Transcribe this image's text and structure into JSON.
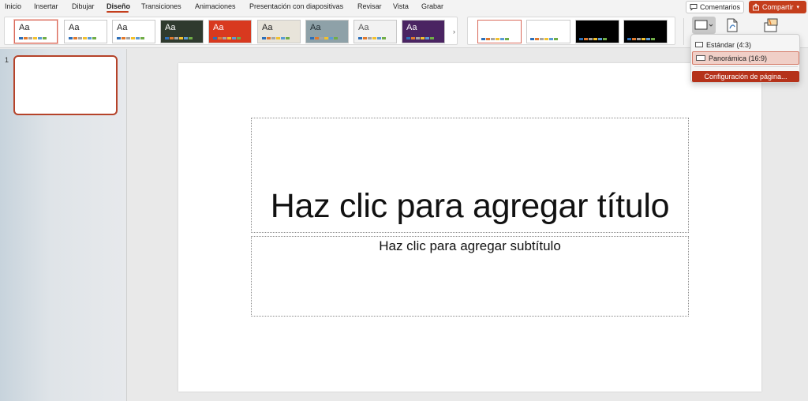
{
  "menu": {
    "tabs": [
      {
        "label": "Inicio"
      },
      {
        "label": "Insertar"
      },
      {
        "label": "Dibujar"
      },
      {
        "label": "Diseño"
      },
      {
        "label": "Transiciones"
      },
      {
        "label": "Animaciones"
      },
      {
        "label": "Presentación con diapositivas"
      },
      {
        "label": "Revisar"
      },
      {
        "label": "Vista"
      },
      {
        "label": "Grabar"
      }
    ],
    "active_tab": "Diseño",
    "comments_label": "Comentarios",
    "share_label": "Compartir"
  },
  "ribbon": {
    "theme_label": "Aa",
    "themes": [
      {
        "name": "blank",
        "bg": "#ffffff",
        "text": "#222222",
        "selected": true
      },
      {
        "name": "office",
        "bg": "#ffffff",
        "text": "#222222",
        "selected": false
      },
      {
        "name": "office-2",
        "bg": "#ffffff",
        "text": "#222222",
        "selected": false
      },
      {
        "name": "dark-green",
        "bg": "#2f3a2e",
        "text": "#ffffff",
        "selected": false
      },
      {
        "name": "red",
        "bg": "#d8391f",
        "text": "#ffffff",
        "selected": false
      },
      {
        "name": "beige",
        "bg": "#e8e4da",
        "text": "#222222",
        "selected": false
      },
      {
        "name": "slate",
        "bg": "#8ea1a8",
        "text": "#1f2a30",
        "selected": false
      },
      {
        "name": "gray-pattern",
        "bg": "#f2f2f2",
        "text": "#555555",
        "selected": false
      },
      {
        "name": "purple",
        "bg": "#4a2462",
        "text": "#ffffff",
        "selected": false
      }
    ],
    "variants": [
      {
        "bg": "#ffffff",
        "selected": true
      },
      {
        "bg": "#ffffff",
        "selected": false
      },
      {
        "bg": "#000000",
        "selected": false
      },
      {
        "bg": "#000000",
        "selected": false
      }
    ]
  },
  "size_dropdown": {
    "items": [
      {
        "label": "Estándar (4:3)",
        "state": "normal"
      },
      {
        "label": "Panorámica (16:9)",
        "state": "hover"
      }
    ],
    "setup_label": "Configuración de página..."
  },
  "slides_panel": {
    "slide_number": "1"
  },
  "slide": {
    "title_placeholder": "Haz clic para agregar título",
    "subtitle_placeholder": "Haz clic para agregar subtítulo"
  },
  "colors": {
    "accent": "#c43e1c",
    "swatches": [
      "#2e6fb7",
      "#e07a2e",
      "#a5a5a5",
      "#f2c12e",
      "#5b9bd5",
      "#70ad47"
    ]
  }
}
